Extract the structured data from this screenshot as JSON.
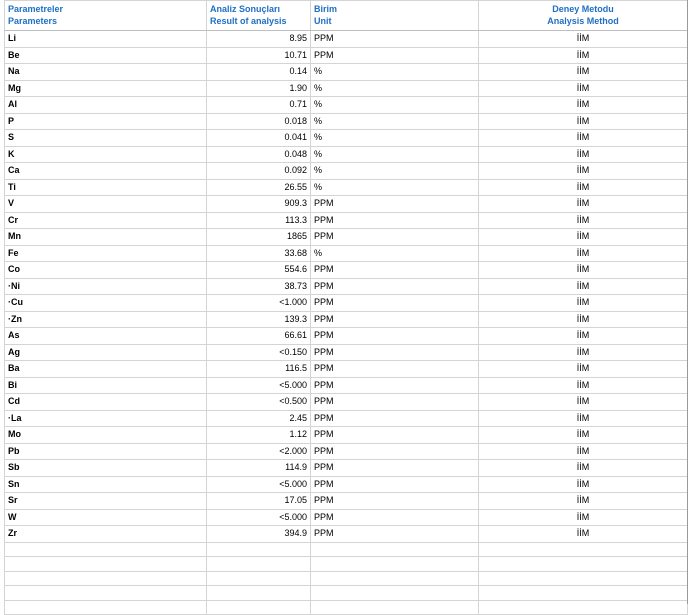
{
  "headers": {
    "param_tr": "Parametreler",
    "param_en": "Parameters",
    "result_tr": "Analiz Sonuçları",
    "result_en": "Result of analysis",
    "unit_tr": "Birim",
    "unit_en": "Unit",
    "method_tr": "Deney Metodu",
    "method_en": "Analysis Method"
  },
  "rows": [
    {
      "param": "Li",
      "value": "8.95",
      "unit": "PPM",
      "method": "İİM"
    },
    {
      "param": "Be",
      "value": "10.71",
      "unit": "PPM",
      "method": "İİM"
    },
    {
      "param": "Na",
      "value": "0.14",
      "unit": "%",
      "method": "İİM"
    },
    {
      "param": "Mg",
      "value": "1.90",
      "unit": "%",
      "method": "İİM"
    },
    {
      "param": "Al",
      "value": "0.71",
      "unit": "%",
      "method": "İİM"
    },
    {
      "param": "P",
      "value": "0.018",
      "unit": "%",
      "method": "İİM"
    },
    {
      "param": "S",
      "value": "0.041",
      "unit": "%",
      "method": "İİM"
    },
    {
      "param": "K",
      "value": "0.048",
      "unit": "%",
      "method": "İİM"
    },
    {
      "param": "Ca",
      "value": "0.092",
      "unit": "%",
      "method": "İİM"
    },
    {
      "param": "Ti",
      "value": "26.55",
      "unit": "%",
      "method": "İİM"
    },
    {
      "param": "V",
      "value": "909.3",
      "unit": "PPM",
      "method": "İİM"
    },
    {
      "param": "Cr",
      "value": "113.3",
      "unit": "PPM",
      "method": "İİM"
    },
    {
      "param": "Mn",
      "value": "1865",
      "unit": "PPM",
      "method": "İİM"
    },
    {
      "param": "Fe",
      "value": "33.68",
      "unit": "%",
      "method": "İİM"
    },
    {
      "param": "Co",
      "value": "554.6",
      "unit": "PPM",
      "method": "İİM"
    },
    {
      "param": "Ni",
      "value": "38.73",
      "unit": "PPM",
      "method": "İİM",
      "dot": true
    },
    {
      "param": "Cu",
      "value": "<1.000",
      "unit": "PPM",
      "method": "İİM",
      "dot": true
    },
    {
      "param": "Zn",
      "value": "139.3",
      "unit": "PPM",
      "method": "İİM",
      "dot": true
    },
    {
      "param": "As",
      "value": "66.61",
      "unit": "PPM",
      "method": "İİM"
    },
    {
      "param": "Ag",
      "value": "<0.150",
      "unit": "PPM",
      "method": "İİM"
    },
    {
      "param": "Ba",
      "value": "116.5",
      "unit": "PPM",
      "method": "İİM"
    },
    {
      "param": "Bi",
      "value": "<5.000",
      "unit": "PPM",
      "method": "İİM"
    },
    {
      "param": "Cd",
      "value": "<0.500",
      "unit": "PPM",
      "method": "İİM"
    },
    {
      "param": "La",
      "value": "2.45",
      "unit": "PPM",
      "method": "İİM",
      "dot": true
    },
    {
      "param": "Mo",
      "value": "1.12",
      "unit": "PPM",
      "method": "İİM"
    },
    {
      "param": "Pb",
      "value": "<2.000",
      "unit": "PPM",
      "method": "İİM"
    },
    {
      "param": "Sb",
      "value": "114.9",
      "unit": "PPM",
      "method": "İİM"
    },
    {
      "param": "Sn",
      "value": "<5.000",
      "unit": "PPM",
      "method": "İİM"
    },
    {
      "param": "Sr",
      "value": "17.05",
      "unit": "PPM",
      "method": "İİM"
    },
    {
      "param": "W",
      "value": "<5.000",
      "unit": "PPM",
      "method": "İİM"
    },
    {
      "param": "Zr",
      "value": "394.9",
      "unit": "PPM",
      "method": "İİM"
    }
  ]
}
